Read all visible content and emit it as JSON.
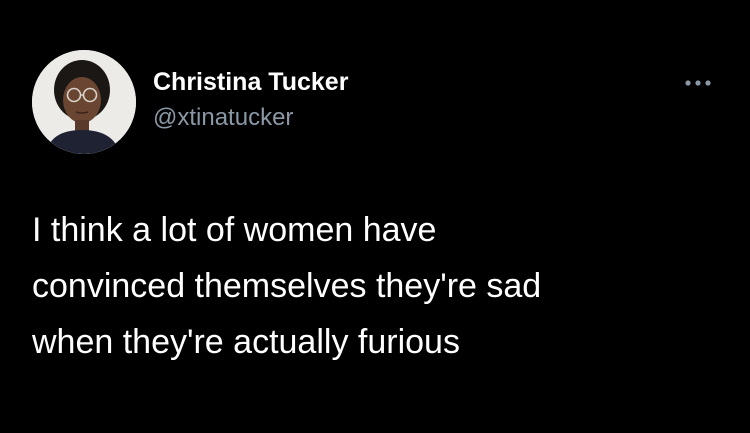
{
  "tweet": {
    "author": {
      "display_name": "Christina Tucker",
      "handle": "@xtinatucker",
      "avatar_icon": "profile-photo"
    },
    "more_icon": "more-options-icon",
    "text": "I think a lot of women have\nconvinced themselves they're sad\nwhen they're actually furious"
  },
  "colors": {
    "background": "#000000",
    "primary_text": "#ffffff",
    "secondary_text": "#8b98a5"
  }
}
